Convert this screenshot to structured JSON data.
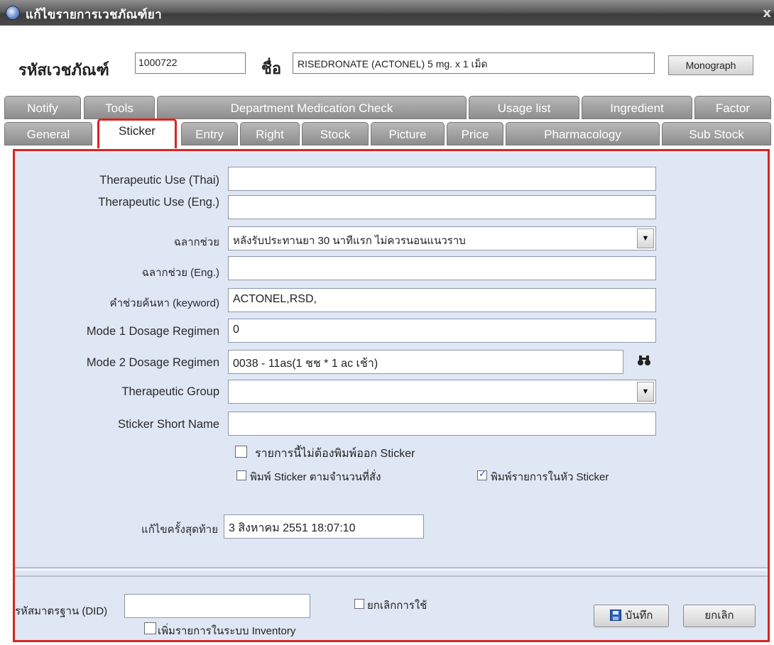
{
  "window": {
    "title": "แก้ไขรายการเวชภัณฑ์ยา",
    "close_glyph": "x"
  },
  "header": {
    "code_label": "รหัสเวชภัณฑ์",
    "code_value": "1000722",
    "name_label": "ชื่อ",
    "name_value": "RISEDRONATE (ACTONEL) 5 mg. x 1 เม็ด",
    "monograph_button": "Monograph"
  },
  "tabs_row1": [
    "Notify",
    "Tools",
    "Department Medication Check",
    "Usage list",
    "Ingredient",
    "Factor"
  ],
  "tabs_row2": [
    "General",
    "Sticker",
    "Entry",
    "Right",
    "Stock",
    "Picture",
    "Price",
    "Pharmacology",
    "Sub Stock"
  ],
  "active_tab": "Sticker",
  "form": {
    "therapeutic_use_thai": {
      "label": "Therapeutic Use (Thai)",
      "value": ""
    },
    "therapeutic_use_eng": {
      "label": "Therapeutic Use (Eng.)",
      "value": ""
    },
    "aux_label": {
      "label": "ฉลากช่วย",
      "value": "หลังรับประทานยา 30 นาทีแรก ไม่ควรนอนแนวราบ"
    },
    "aux_label_eng": {
      "label": "ฉลากช่วย (Eng.)",
      "value": ""
    },
    "keyword": {
      "label": "คำช่วยค้นหา (keyword)",
      "value": "ACTONEL,RSD,"
    },
    "mode1": {
      "label": "Mode 1 Dosage Regimen",
      "value": "0"
    },
    "mode2": {
      "label": "Mode 2 Dosage Regimen",
      "value": "0038 - 11as(1 ชช * 1 ac เช้า)"
    },
    "therapeutic_group": {
      "label": "Therapeutic Group",
      "value": ""
    },
    "sticker_short_name": {
      "label": "Sticker Short Name",
      "value": ""
    },
    "no_print_sticker": {
      "label": "รายการนี้ไม่ต้องพิมพ์ออก Sticker",
      "checked": false
    },
    "print_by_qty": {
      "label": "พิมพ์ Sticker ตามจำนวนที่สั่ง",
      "checked": false
    },
    "print_in_header": {
      "label": "พิมพ์รายการในหัว Sticker",
      "checked": true
    },
    "last_modified": {
      "label": "แก้ไขครั้งสุดท้าย",
      "value": "3 สิงหาคม 2551 18:07:10"
    }
  },
  "footer": {
    "did_label": "รหัสมาตรฐาน (DID)",
    "did_value": "",
    "cancel_use_label": "ยกเลิกการใช้",
    "cancel_use_checked": false,
    "inventory_label": "เพิ่มรายการในระบบ Inventory",
    "inventory_checked": false,
    "save_button": "บันทึก",
    "cancel_button": "ยกเลิก"
  },
  "colors": {
    "panel_bg": "#dfe7f5",
    "highlight": "#d62525",
    "tab_bg": "#a3a3a3"
  }
}
